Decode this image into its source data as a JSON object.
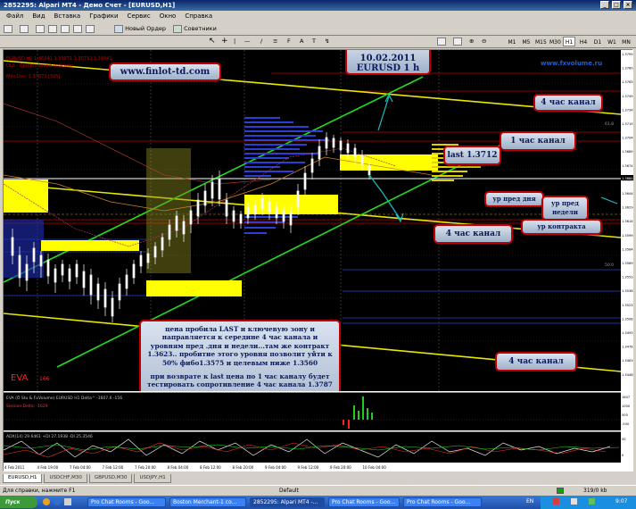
{
  "window": {
    "title": "2852295: Alpari MT4 - Демо Счет - [EURUSD,H1]"
  },
  "menu": [
    "Файл",
    "Вид",
    "Вставка",
    "Графики",
    "Сервис",
    "Окно",
    "Справка"
  ],
  "toolbar": {
    "new_order": "Новый Ордер",
    "experts": "Советники"
  },
  "timeframes": [
    "M1",
    "M5",
    "M15",
    "M30",
    "H1",
    "H4",
    "D1",
    "W1",
    "MN"
  ],
  "selected_timeframe": "H1",
  "chart": {
    "symbol_line": "EURUSD,H1  1.36941 1.36971 1.36792 1.36841",
    "indicator_line1": "DLS - Options Levels Indicator",
    "indicator_line2": "Max Day: 1.37873 [395]",
    "site_left": "www.finlot-td.com",
    "site_right": "www.fxvolume.ru",
    "date_label": "10.02.2011",
    "pair_label": "EURUSD 1 h",
    "eva_label": "EVA",
    "eva_value": "166",
    "sub1_label": "EVA (Ö Stu & FxVolume) EURUSD H1 Delta^ -1607.6 -156",
    "sub1_label2": "Session Delta: -1629",
    "sub2_label": "ADX(14) 29.6461 +DI 27.1938 -DI 25.3546",
    "price_marker_left": "61.8",
    "price_marker_right": "50.0",
    "current_price": "1.36841",
    "price_ticks": [
      "1.37950",
      "1.37800",
      "1.37650",
      "1.37495",
      "1.37345",
      "1.37195",
      "1.37045",
      "1.36895",
      "1.36745",
      "1.36595",
      "1.36440",
      "1.36290",
      "1.36140",
      "1.35990",
      "1.35840",
      "1.35690",
      "1.35535",
      "1.35385",
      "1.35235",
      "1.35085",
      "1.34935",
      "1.34785",
      "1.34630",
      "1.34480"
    ],
    "sub1_ticks": [
      "1607",
      "1000",
      "500",
      "-500"
    ],
    "sub2_ticks": [
      "50",
      "0"
    ],
    "time_ticks": [
      "4 Feb 2011",
      "4 Feb 19:00",
      "7 Feb 04:00",
      "7 Feb 12:00",
      "7 Feb 20:00",
      "8 Feb 04:00",
      "8 Feb 12:00",
      "8 Feb 20:00",
      "9 Feb 04:00",
      "9 Feb 12:00",
      "9 Feb 20:00",
      "10 Feb 04:00"
    ]
  },
  "callouts": {
    "ch4_top": "4 час канал",
    "ch1": "1 час канал",
    "last": "last 1.3712",
    "prev_day": "ур пред дня",
    "prev_week": "ур пред недели",
    "contract": "ур контракта",
    "ch4_mid": "4 час канал",
    "ch4_bottom": "4 час канал",
    "analysis_1": "цена пробила  LAST и ключевую зону и направляется к середине 4 час канала и уровням пред .дня и недели...там же контракт 1.3623.. пробитие этого уровня позволит уйти к 50% фибо1.3575 и целевым ниже 1.3560",
    "analysis_2": " при возврате  к last цена по 1 час каналу  будет тестировать сопротивление  4 час канала 1.3787"
  },
  "tabs": [
    "EURUSD,H1",
    "USDCHF,M30",
    "GBPUSD,M30",
    "USDJPY,H1"
  ],
  "active_tab": "EURUSD,H1",
  "status": {
    "help": "Для справки, нажмите F1",
    "profile": "Default",
    "traffic": "319/0 kb"
  },
  "taskbar": {
    "start": "Пуск",
    "tasks": [
      "Pro Chat Rooms - Goo...",
      "Boston Merchant-1 co...",
      "2852295: Alpari MT4 -...",
      "Pro Chat Rooms - Goo...",
      "Pro Chat Rooms - Goo..."
    ],
    "lang": "EN",
    "clock": "9:07"
  },
  "colors": {
    "ch4": "#e8e800",
    "ch1": "#22dd22",
    "box": "#ffff00",
    "profile": "#2b3fd6",
    "callout_border": "#c00000"
  }
}
